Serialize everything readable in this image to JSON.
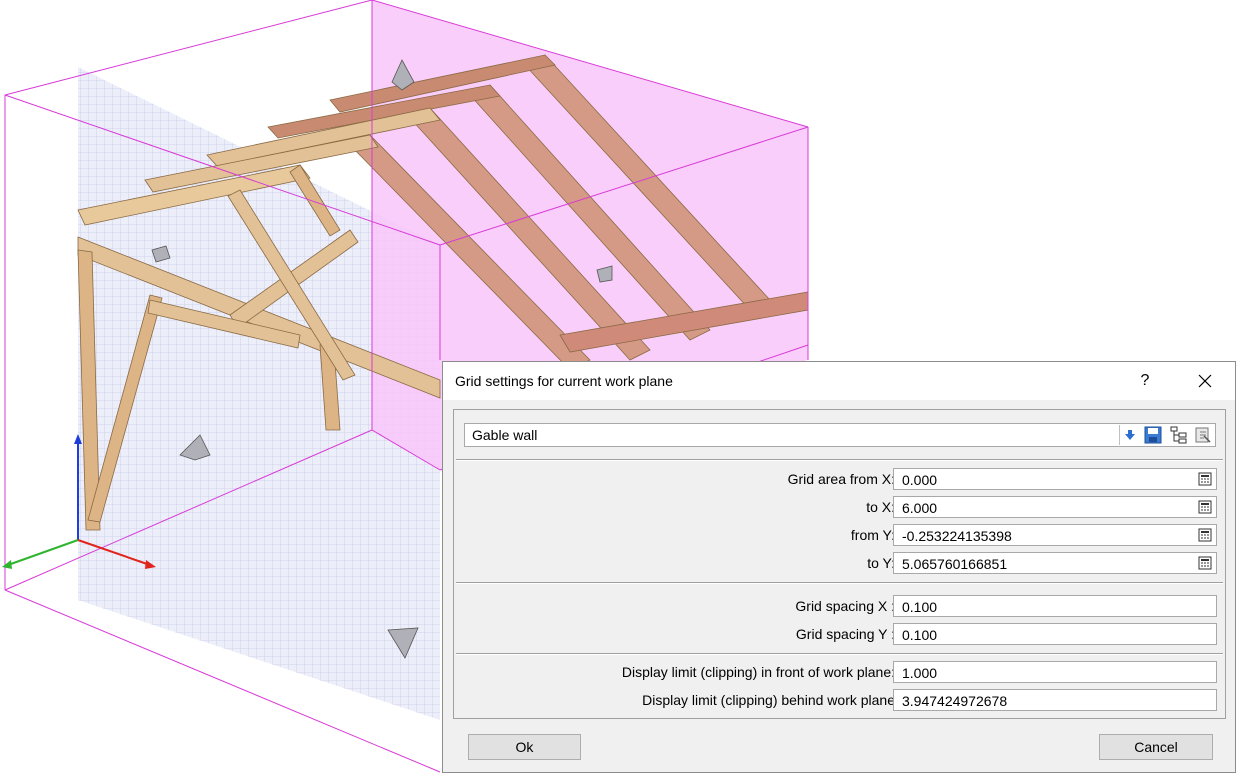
{
  "dialog": {
    "title": "Grid settings for current work plane",
    "help_label": "?",
    "preset": {
      "value": "Gable wall"
    },
    "area_fields": [
      {
        "label": "Grid area from X:",
        "value": "0.000"
      },
      {
        "label": "to X:",
        "value": "6.000"
      },
      {
        "label": "from Y:",
        "value": "-0.253224135398"
      },
      {
        "label": "to Y:",
        "value": "5.065760166851"
      }
    ],
    "spacing_fields": [
      {
        "label": "Grid spacing X :",
        "value": "0.100"
      },
      {
        "label": "Grid spacing Y :",
        "value": "0.100"
      }
    ],
    "clipping_fields": [
      {
        "label": "Display limit (clipping) in front of work plane:",
        "value": "1.000"
      },
      {
        "label": "Display limit (clipping) behind work plane",
        "value": "3.947424972678"
      }
    ],
    "ok_label": "Ok",
    "cancel_label": "Cancel"
  },
  "icons": {
    "preset_dropdown": "arrow-down-icon",
    "save": "save-icon",
    "tree": "tree-view-icon",
    "export": "export-icon",
    "calculator": "calculator-icon",
    "close": "close-icon"
  },
  "colors": {
    "work_plane": "#f9c6f9",
    "bounding_box": "#d83ad8",
    "timber_light": "#e2c196",
    "timber_dark": "#c8976a",
    "axis_x": "#e0241c",
    "axis_y": "#2fb52f",
    "axis_z": "#1d3fd8"
  }
}
